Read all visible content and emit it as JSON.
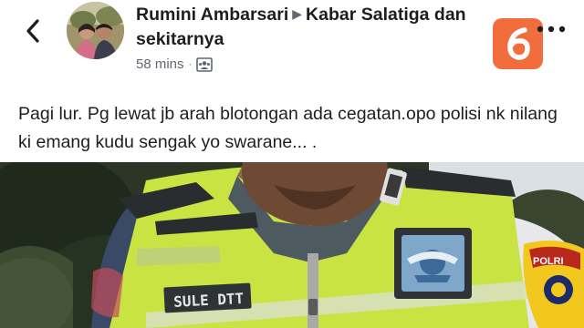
{
  "header": {
    "back_icon": "chevron-left-icon",
    "author": "Rumini Ambarsari",
    "separator_icon": "right-triangle-icon",
    "group": "Kabar Salatiga dan sekitarnya",
    "timestamp": "58 mins",
    "meta_separator": "·",
    "audience_icon": "group-audience-icon",
    "more_icon": "more-horizontal-icon"
  },
  "post": {
    "text": "Pagi lur. Pg lewat jb arah blotongan ada cegatan.opo polisi nk nilang ki emang kudu sengak yo swarane... ."
  },
  "photo": {
    "name_tag": "SULE DTT",
    "shoulder_patch": "POLRI"
  },
  "watermark": {
    "digit": "6",
    "color": "#f05a22"
  }
}
